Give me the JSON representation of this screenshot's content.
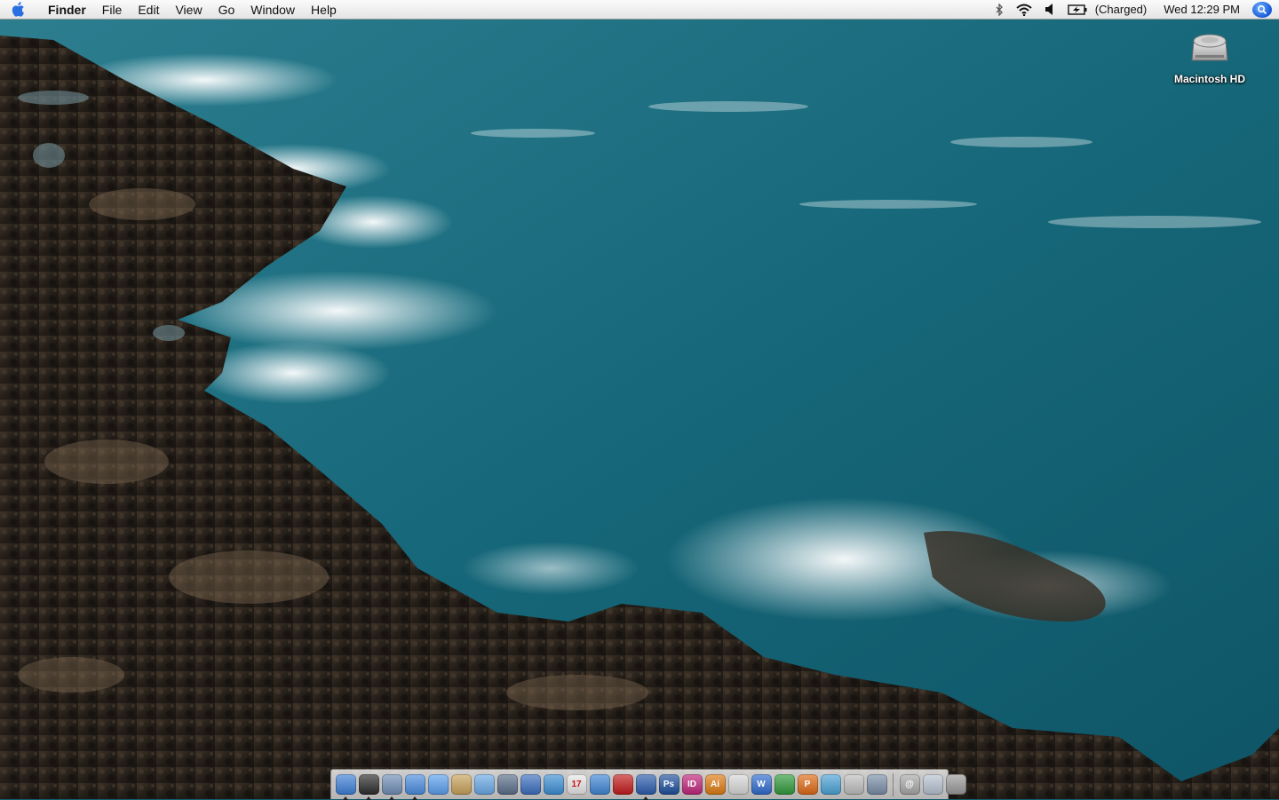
{
  "menubar": {
    "apple_icon": "apple-icon",
    "app_name": "Finder",
    "menus": [
      "File",
      "Edit",
      "View",
      "Go",
      "Window",
      "Help"
    ],
    "status": {
      "battery_text": "(Charged)",
      "clock": "Wed 12:29 PM"
    },
    "status_icons": [
      "bluetooth-icon",
      "wifi-icon",
      "volume-icon",
      "battery-icon",
      "spotlight-icon"
    ]
  },
  "desktop": {
    "icons": [
      {
        "label": "Macintosh HD",
        "icon": "hard-drive-icon"
      }
    ]
  },
  "dock": {
    "apps": [
      {
        "name": "finder-icon",
        "glyph": "",
        "color": "#3d7fd8",
        "running": true
      },
      {
        "name": "dashboard-icon",
        "glyph": "",
        "color": "#2b2b2b",
        "running": true
      },
      {
        "name": "preview-icon",
        "glyph": "",
        "color": "#6f8fb8",
        "running": true
      },
      {
        "name": "safari-icon",
        "glyph": "",
        "color": "#4a8de0",
        "running": true
      },
      {
        "name": "ichat-icon",
        "glyph": "",
        "color": "#5aa0f0",
        "running": false
      },
      {
        "name": "address-book-icon",
        "glyph": "",
        "color": "#c9a35a",
        "running": false
      },
      {
        "name": "itunes-icon",
        "glyph": "",
        "color": "#6aa9e8",
        "running": false
      },
      {
        "name": "iphoto-icon",
        "glyph": "",
        "color": "#5a6e8a",
        "running": false
      },
      {
        "name": "imovie-icon",
        "glyph": "",
        "color": "#3a6ec0",
        "running": false
      },
      {
        "name": "mail-icon",
        "glyph": "",
        "color": "#3c8fd6",
        "running": false
      },
      {
        "name": "ical-icon",
        "glyph": "17",
        "color": "#e8e8e8",
        "running": false
      },
      {
        "name": "system-preferences-icon",
        "glyph": "",
        "color": "#3f86d6",
        "running": false
      },
      {
        "name": "flash-icon",
        "glyph": "",
        "color": "#c41a1a",
        "running": false
      },
      {
        "name": "network-icon",
        "glyph": "",
        "color": "#2a5cae",
        "running": true
      },
      {
        "name": "photoshop-icon",
        "glyph": "Ps",
        "color": "#1d4f9c",
        "running": false
      },
      {
        "name": "indesign-icon",
        "glyph": "ID",
        "color": "#c0247a",
        "running": false
      },
      {
        "name": "illustrator-icon",
        "glyph": "Ai",
        "color": "#e07b12",
        "running": false
      },
      {
        "name": "textedit-icon",
        "glyph": "",
        "color": "#d9d9d9",
        "running": false
      },
      {
        "name": "word-icon",
        "glyph": "W",
        "color": "#2e6bd0",
        "running": false
      },
      {
        "name": "excel-icon",
        "glyph": "",
        "color": "#2f9a3a",
        "running": false
      },
      {
        "name": "powerpoint-icon",
        "glyph": "P",
        "color": "#e06a14",
        "running": false
      },
      {
        "name": "messenger-icon",
        "glyph": "",
        "color": "#4aa3d8",
        "running": false
      },
      {
        "name": "screenshot-icon",
        "glyph": "",
        "color": "#bfbfbf",
        "running": false
      },
      {
        "name": "image-capture-icon",
        "glyph": "",
        "color": "#7a8fa8",
        "running": false
      }
    ],
    "right_items": [
      {
        "name": "downloads-stack-icon",
        "glyph": "@",
        "color": "#a8a8a8"
      },
      {
        "name": "documents-folder-icon",
        "glyph": "",
        "color": "#b7c3d1"
      },
      {
        "name": "trash-icon",
        "glyph": "",
        "color": "#9a9a9a"
      }
    ]
  }
}
